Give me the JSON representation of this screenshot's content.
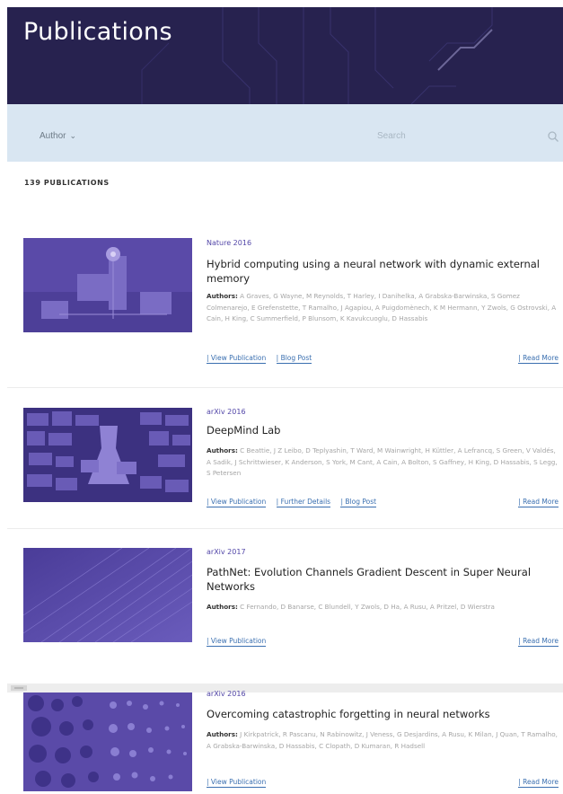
{
  "hero": {
    "title": "Publications"
  },
  "filter": {
    "author_label": "Author",
    "search_placeholder": "Search"
  },
  "count_label": "139 PUBLICATIONS",
  "publications": [
    {
      "venue": "Nature 2016",
      "title": "Hybrid computing using a neural network with dynamic external memory",
      "authors_label": "Authors:",
      "authors": "A Graves, G Wayne, M Reynolds, T Harley, I Danihelka, A Grabska-Barwinska, S Gomez Colmenarejo, E Grefenstette, T Ramalho, J Agapiou, A Puigdomènech, K M Hermann, Y Zwols, G Ostrovski, A Cain, H King, C Summerfield, P Blunsom, K Kavukcuoglu, D Hassabis",
      "links": [
        "| View Publication",
        "| Blog Post"
      ],
      "read_more": "| Read More"
    },
    {
      "venue": "arXiv 2016",
      "title": "DeepMind Lab",
      "authors_label": "Authors:",
      "authors": "C Beattie, J Z Leibo, D Teplyashin, T Ward, M Wainwright, H Küttler, A Lefrancq, S Green, V Valdés, A Sadik, J Schrittwieser, K Anderson, S York, M Cant, A Cain, A Bolton, S Gaffney, H King, D Hassabis, S Legg, S Petersen",
      "links": [
        "| View Publication",
        "| Further Details",
        "| Blog Post"
      ],
      "read_more": "| Read More"
    },
    {
      "venue": "arXiv 2017",
      "title": "PathNet: Evolution Channels Gradient Descent in Super Neural Networks",
      "authors_label": "Authors:",
      "authors": "C Fernando, D Banarse, C Blundell, Y Zwols, D Ha, A Rusu, A Pritzel, D Wierstra",
      "links": [
        "| View Publication"
      ],
      "read_more": "| Read More"
    },
    {
      "venue": "arXiv 2016",
      "title": "Overcoming catastrophic forgetting in neural networks",
      "authors_label": "Authors:",
      "authors": "J Kirkpatrick, R Pascanu, N Rabinowitz, J Veness, G Desjardins, A Rusu, K Milan, J Quan, T Ramalho, A Grabska-Barwinska, D Hassabis, C Clopath, D Kumaran, R Hadsell",
      "links": [
        "| View Publication"
      ],
      "read_more": "| Read More"
    }
  ],
  "colors": {
    "hero_bg": "#27224f",
    "filter_bg": "#d9e6f2",
    "thumb_purple": "#5f4fb0",
    "venue": "#5347a8",
    "link": "#3a6fb0"
  }
}
